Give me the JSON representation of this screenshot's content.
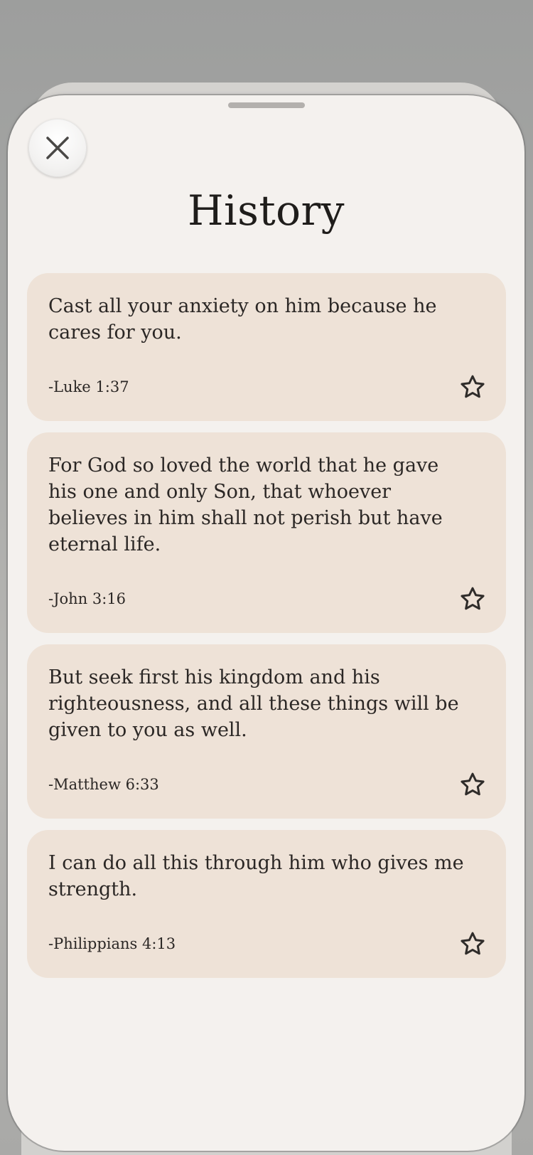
{
  "header": {
    "title": "History"
  },
  "icons": {
    "close": "close-icon",
    "favorite": "star-outline-icon"
  },
  "colors": {
    "sheet_background": "#f4f1ee",
    "card_background": "#eee2d7",
    "text": "#2b2725"
  },
  "history": {
    "items": [
      {
        "text": "Cast all your anxiety on him because he cares for you.",
        "reference": "-Luke 1:37"
      },
      {
        "text": "For God so loved the world that he gave his one and only Son, that whoever believes in him shall not perish but have eternal life.",
        "reference": "-John 3:16"
      },
      {
        "text": "But seek first his kingdom and his righteousness, and all these things will be given to you as well.",
        "reference": "-Matthew 6:33"
      },
      {
        "text": "I can do all this through him who gives me strength.",
        "reference": "-Philippians 4:13"
      }
    ]
  }
}
